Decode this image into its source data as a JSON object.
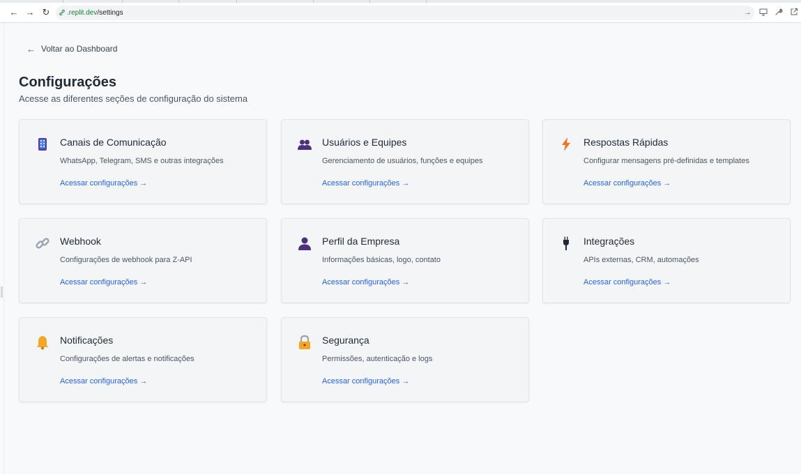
{
  "browser": {
    "url_host": ".replit.dev",
    "url_path": "/settings"
  },
  "page": {
    "back_label": "Voltar ao Dashboard",
    "title": "Configurações",
    "subtitle": "Acesse as diferentes seções de configuração do sistema"
  },
  "cards": [
    {
      "icon": "smartphone-icon",
      "title": "Canais de Comunicação",
      "description": "WhatsApp, Telegram, SMS e outras integrações",
      "link": "Acessar configurações →"
    },
    {
      "icon": "users-icon",
      "title": "Usuários e Equipes",
      "description": "Gerenciamento de usuários, funções e equipes",
      "link": "Acessar configurações →"
    },
    {
      "icon": "lightning-icon",
      "title": "Respostas Rápidas",
      "description": "Configurar mensagens pré-definidas e templates",
      "link": "Acessar configurações →"
    },
    {
      "icon": "link-icon",
      "title": "Webhook",
      "description": "Configurações de webhook para Z-API",
      "link": "Acessar configurações →"
    },
    {
      "icon": "person-icon",
      "title": "Perfil da Empresa",
      "description": "Informações básicas, logo, contato",
      "link": "Acessar configurações →"
    },
    {
      "icon": "plug-icon",
      "title": "Integrações",
      "description": "APIs externas, CRM, automações",
      "link": "Acessar configurações →"
    },
    {
      "icon": "bell-icon",
      "title": "Notificações",
      "description": "Configurações de alertas e notificações",
      "link": "Acessar configurações →"
    },
    {
      "icon": "lock-icon",
      "title": "Segurança",
      "description": "Permissões, autenticação e logs",
      "link": "Acessar configurações →"
    }
  ],
  "colors": {
    "link": "#2563eb",
    "background": "#f8f9fb",
    "card_background": "#f3f5f7",
    "card_border": "#e1e4e8"
  }
}
